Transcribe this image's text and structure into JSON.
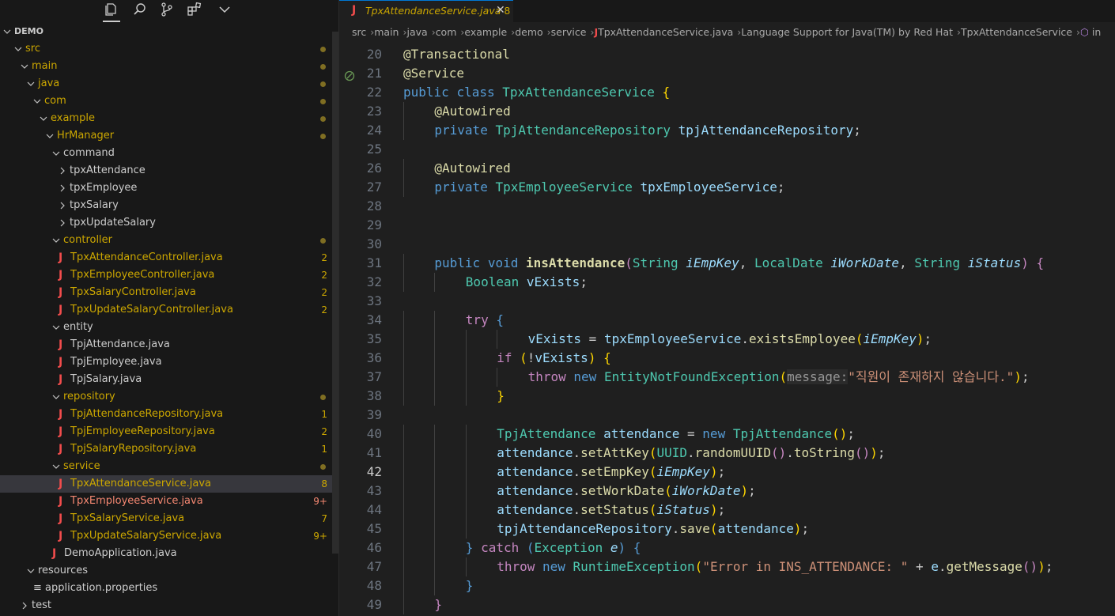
{
  "sidebar": {
    "toolbar": [
      {
        "name": "explorer-icon"
      },
      {
        "name": "search-icon"
      },
      {
        "name": "source-control-icon"
      },
      {
        "name": "extensions-icon"
      },
      {
        "name": "chevron-down-icon"
      }
    ],
    "tree": [
      {
        "label": "DEMO",
        "depth": 0,
        "kind": "folder-open",
        "style": "bold"
      },
      {
        "label": "src",
        "depth": 1,
        "kind": "folder-open",
        "style": "mod",
        "badge": "dot"
      },
      {
        "label": "main",
        "depth": 2,
        "kind": "folder-open",
        "style": "mod",
        "badge": "dot"
      },
      {
        "label": "java",
        "depth": 3,
        "kind": "folder-open",
        "style": "mod",
        "badge": "dot"
      },
      {
        "label": "com",
        "depth": 4,
        "kind": "folder-open",
        "style": "mod",
        "badge": "dot"
      },
      {
        "label": "example",
        "depth": 5,
        "kind": "folder-open",
        "style": "mod",
        "badge": "dot"
      },
      {
        "label": "HrManager",
        "depth": 6,
        "kind": "folder-open",
        "style": "mod",
        "badge": "dot"
      },
      {
        "label": "command",
        "depth": 7,
        "kind": "folder-open",
        "style": ""
      },
      {
        "label": "tpxAttendance",
        "depth": 8,
        "kind": "folder-closed",
        "style": ""
      },
      {
        "label": "tpxEmployee",
        "depth": 8,
        "kind": "folder-closed",
        "style": ""
      },
      {
        "label": "tpxSalary",
        "depth": 8,
        "kind": "folder-closed",
        "style": ""
      },
      {
        "label": "tpxUpdateSalary",
        "depth": 8,
        "kind": "folder-closed",
        "style": ""
      },
      {
        "label": "controller",
        "depth": 7,
        "kind": "folder-open",
        "style": "mod",
        "badge": "dot"
      },
      {
        "label": "TpxAttendanceController.java",
        "depth": 8,
        "kind": "java",
        "style": "mod",
        "count": "2"
      },
      {
        "label": "TpxEmployeeController.java",
        "depth": 8,
        "kind": "java",
        "style": "mod",
        "count": "2"
      },
      {
        "label": "TpxSalaryController.java",
        "depth": 8,
        "kind": "java",
        "style": "mod",
        "count": "2"
      },
      {
        "label": "TpxUpdateSalaryController.java",
        "depth": 8,
        "kind": "java",
        "style": "mod",
        "count": "2"
      },
      {
        "label": "entity",
        "depth": 7,
        "kind": "folder-open",
        "style": ""
      },
      {
        "label": "TpjAttendance.java",
        "depth": 8,
        "kind": "java",
        "style": ""
      },
      {
        "label": "TpjEmployee.java",
        "depth": 8,
        "kind": "java",
        "style": ""
      },
      {
        "label": "TpjSalary.java",
        "depth": 8,
        "kind": "java",
        "style": ""
      },
      {
        "label": "repository",
        "depth": 7,
        "kind": "folder-open",
        "style": "mod",
        "badge": "dot"
      },
      {
        "label": "TpjAttendanceRepository.java",
        "depth": 8,
        "kind": "java",
        "style": "mod",
        "count": "1"
      },
      {
        "label": "TpjEmployeeRepository.java",
        "depth": 8,
        "kind": "java",
        "style": "mod",
        "count": "2"
      },
      {
        "label": "TpjSalaryRepository.java",
        "depth": 8,
        "kind": "java",
        "style": "mod",
        "count": "1"
      },
      {
        "label": "service",
        "depth": 7,
        "kind": "folder-open",
        "style": "mod",
        "badge": "dot"
      },
      {
        "label": "TpxAttendanceService.java",
        "depth": 8,
        "kind": "java",
        "style": "mod",
        "count": "8",
        "selected": true
      },
      {
        "label": "TpxEmployeeService.java",
        "depth": 8,
        "kind": "java",
        "style": "err",
        "count": "9+"
      },
      {
        "label": "TpxSalaryService.java",
        "depth": 8,
        "kind": "java",
        "style": "mod",
        "count": "7"
      },
      {
        "label": "TpxUpdateSalaryService.java",
        "depth": 8,
        "kind": "java",
        "style": "mod",
        "count": "9+"
      },
      {
        "label": "DemoApplication.java",
        "depth": 7,
        "kind": "java",
        "style": ""
      },
      {
        "label": "resources",
        "depth": 3,
        "kind": "folder-open",
        "style": ""
      },
      {
        "label": "application.properties",
        "depth": 4,
        "kind": "gear",
        "style": ""
      },
      {
        "label": "test",
        "depth": 2,
        "kind": "folder-closed",
        "style": ""
      }
    ]
  },
  "tab": {
    "label": "TpxAttendanceService.java",
    "problems": "8",
    "close": "✕"
  },
  "breadcrumb": [
    "src",
    "main",
    "java",
    "com",
    "example",
    "demo",
    "service",
    "TpxAttendanceService.java",
    "Language Support for Java(TM) by Red Hat",
    "TpxAttendanceService",
    "in"
  ],
  "current_line": 42,
  "code": [
    {
      "n": 20,
      "indent": 0,
      "t": [
        [
          "an",
          "@Transactional"
        ]
      ]
    },
    {
      "n": 21,
      "indent": 0,
      "gutter": true,
      "t": [
        [
          "an",
          "@Service"
        ]
      ]
    },
    {
      "n": 22,
      "indent": 0,
      "t": [
        [
          "kw",
          "public"
        ],
        [
          "",
          "",
          " "
        ],
        [
          "kw",
          "class"
        ],
        [
          "",
          " "
        ],
        [
          "ty",
          "TpxAttendanceService"
        ],
        [
          "",
          " "
        ],
        [
          "pa",
          "{"
        ]
      ]
    },
    {
      "n": 23,
      "indent": 1,
      "t": [
        [
          "an",
          "@Autowired"
        ]
      ]
    },
    {
      "n": 24,
      "indent": 1,
      "t": [
        [
          "kw",
          "private"
        ],
        [
          "",
          " "
        ],
        [
          "ty",
          "TpjAttendanceRepository"
        ],
        [
          "",
          " "
        ],
        [
          "va",
          "tpjAttendanceRepository"
        ],
        [
          "",
          ";"
        ]
      ]
    },
    {
      "n": 25,
      "indent": 0,
      "t": []
    },
    {
      "n": 26,
      "indent": 1,
      "t": [
        [
          "an",
          "@Autowired"
        ]
      ]
    },
    {
      "n": 27,
      "indent": 1,
      "t": [
        [
          "kw",
          "private"
        ],
        [
          "",
          " "
        ],
        [
          "ty",
          "TpxEmployeeService"
        ],
        [
          "",
          " "
        ],
        [
          "va",
          "tpxEmployeeService"
        ],
        [
          "",
          ";"
        ]
      ]
    },
    {
      "n": 28,
      "indent": 0,
      "t": []
    },
    {
      "n": 29,
      "indent": 0,
      "t": []
    },
    {
      "n": 30,
      "indent": 0,
      "t": []
    },
    {
      "n": 31,
      "indent": 1,
      "t": [
        [
          "kw",
          "public"
        ],
        [
          "",
          " "
        ],
        [
          "kw",
          "void"
        ],
        [
          "",
          " "
        ],
        [
          "fn bold",
          "insAttendance"
        ],
        [
          "ctl",
          "("
        ],
        [
          "ty",
          "String"
        ],
        [
          "",
          " "
        ],
        [
          "va it",
          "iEmpKey"
        ],
        [
          "",
          ", "
        ],
        [
          "ty",
          "LocalDate"
        ],
        [
          "",
          " "
        ],
        [
          "va it",
          "iWorkDate"
        ],
        [
          "",
          ", "
        ],
        [
          "ty",
          "String"
        ],
        [
          "",
          " "
        ],
        [
          "va it",
          "iStatus"
        ],
        [
          "ctl",
          ")"
        ],
        [
          "",
          " "
        ],
        [
          "ctl",
          "{"
        ]
      ]
    },
    {
      "n": 32,
      "indent": 2,
      "t": [
        [
          "ty",
          "Boolean"
        ],
        [
          "",
          " "
        ],
        [
          "va",
          "vExists"
        ],
        [
          "",
          ";"
        ]
      ]
    },
    {
      "n": 33,
      "indent": 0,
      "t": []
    },
    {
      "n": 34,
      "indent": 2,
      "t": [
        [
          "ctl",
          "try"
        ],
        [
          "",
          " "
        ],
        [
          "kw",
          "{"
        ]
      ]
    },
    {
      "n": 35,
      "indent": 4,
      "t": [
        [
          "va",
          "vExists"
        ],
        [
          "",
          " = "
        ],
        [
          "va",
          "tpxEmployeeService"
        ],
        [
          "",
          "."
        ],
        [
          "fn",
          "existsEmployee"
        ],
        [
          "pa",
          "("
        ],
        [
          "va it",
          "iEmpKey"
        ],
        [
          "pa",
          ")"
        ],
        [
          "",
          ";"
        ]
      ]
    },
    {
      "n": 36,
      "indent": 3,
      "t": [
        [
          "ctl",
          "if"
        ],
        [
          "",
          " "
        ],
        [
          "pa",
          "("
        ],
        [
          "",
          "!"
        ],
        [
          "va",
          "vExists"
        ],
        [
          "pa",
          ")"
        ],
        [
          "",
          " "
        ],
        [
          "pa",
          "{"
        ]
      ]
    },
    {
      "n": 37,
      "indent": 4,
      "t": [
        [
          "ctl",
          "throw"
        ],
        [
          "",
          " "
        ],
        [
          "kw",
          "new"
        ],
        [
          "",
          " "
        ],
        [
          "ty",
          "EntityNotFoundException"
        ],
        [
          "pa",
          "("
        ],
        [
          "hint",
          "message:"
        ],
        [
          "st",
          "\"직원이 존재하지 않습니다.\""
        ],
        [
          "pa",
          ")"
        ],
        [
          "",
          ";"
        ]
      ]
    },
    {
      "n": 38,
      "indent": 3,
      "t": [
        [
          "pa",
          "}"
        ]
      ]
    },
    {
      "n": 39,
      "indent": 0,
      "t": []
    },
    {
      "n": 40,
      "indent": 3,
      "t": [
        [
          "ty",
          "TpjAttendance"
        ],
        [
          "",
          " "
        ],
        [
          "va",
          "attendance"
        ],
        [
          "",
          " = "
        ],
        [
          "kw",
          "new"
        ],
        [
          "",
          " "
        ],
        [
          "ty",
          "TpjAttendance"
        ],
        [
          "pa",
          "()"
        ],
        [
          "",
          ";"
        ]
      ]
    },
    {
      "n": 41,
      "indent": 3,
      "t": [
        [
          "va",
          "attendance"
        ],
        [
          "",
          "."
        ],
        [
          "fn",
          "setAttKey"
        ],
        [
          "pa",
          "("
        ],
        [
          "ty",
          "UUID"
        ],
        [
          "",
          "."
        ],
        [
          "fn",
          "randomUUID"
        ],
        [
          "ctl",
          "()"
        ],
        [
          "",
          "."
        ],
        [
          "fn",
          "toString"
        ],
        [
          "ctl",
          "()"
        ],
        [
          "pa",
          ")"
        ],
        [
          "",
          ";"
        ]
      ]
    },
    {
      "n": 42,
      "indent": 3,
      "t": [
        [
          "va",
          "attendance"
        ],
        [
          "",
          "."
        ],
        [
          "fn",
          "setEmpKey"
        ],
        [
          "pa",
          "("
        ],
        [
          "va it",
          "iEmpKey"
        ],
        [
          "pa",
          ")"
        ],
        [
          "",
          ";"
        ]
      ]
    },
    {
      "n": 43,
      "indent": 3,
      "t": [
        [
          "va",
          "attendance"
        ],
        [
          "",
          "."
        ],
        [
          "fn",
          "setWorkDate"
        ],
        [
          "pa",
          "("
        ],
        [
          "va it",
          "iWorkDate"
        ],
        [
          "pa",
          ")"
        ],
        [
          "",
          ";"
        ]
      ]
    },
    {
      "n": 44,
      "indent": 3,
      "t": [
        [
          "va",
          "attendance"
        ],
        [
          "",
          "."
        ],
        [
          "fn",
          "setStatus"
        ],
        [
          "pa",
          "("
        ],
        [
          "va it",
          "iStatus"
        ],
        [
          "pa",
          ")"
        ],
        [
          "",
          ";"
        ]
      ]
    },
    {
      "n": 45,
      "indent": 3,
      "t": [
        [
          "va",
          "tpjAttendanceRepository"
        ],
        [
          "",
          "."
        ],
        [
          "fn",
          "save"
        ],
        [
          "pa",
          "("
        ],
        [
          "va",
          "attendance"
        ],
        [
          "pa",
          ")"
        ],
        [
          "",
          ";"
        ]
      ]
    },
    {
      "n": 46,
      "indent": 2,
      "t": [
        [
          "kw",
          "}"
        ],
        [
          "",
          " "
        ],
        [
          "ctl",
          "catch"
        ],
        [
          "",
          " "
        ],
        [
          "kw",
          "("
        ],
        [
          "ty",
          "Exception"
        ],
        [
          "",
          " "
        ],
        [
          "va it",
          "e"
        ],
        [
          "kw",
          ")"
        ],
        [
          "",
          " "
        ],
        [
          "kw",
          "{"
        ]
      ]
    },
    {
      "n": 47,
      "indent": 3,
      "t": [
        [
          "ctl",
          "throw"
        ],
        [
          "",
          " "
        ],
        [
          "kw",
          "new"
        ],
        [
          "",
          " "
        ],
        [
          "ty",
          "RuntimeException"
        ],
        [
          "pa",
          "("
        ],
        [
          "st",
          "\"Error in INS_ATTENDANCE: \""
        ],
        [
          "",
          " + "
        ],
        [
          "va",
          "e"
        ],
        [
          "",
          "."
        ],
        [
          "fn",
          "getMessage"
        ],
        [
          "ctl",
          "()"
        ],
        [
          "pa",
          ")"
        ],
        [
          "",
          ";"
        ]
      ]
    },
    {
      "n": 48,
      "indent": 2,
      "t": [
        [
          "kw",
          "}"
        ]
      ]
    },
    {
      "n": 49,
      "indent": 1,
      "t": [
        [
          "ctl",
          "}"
        ]
      ]
    }
  ]
}
